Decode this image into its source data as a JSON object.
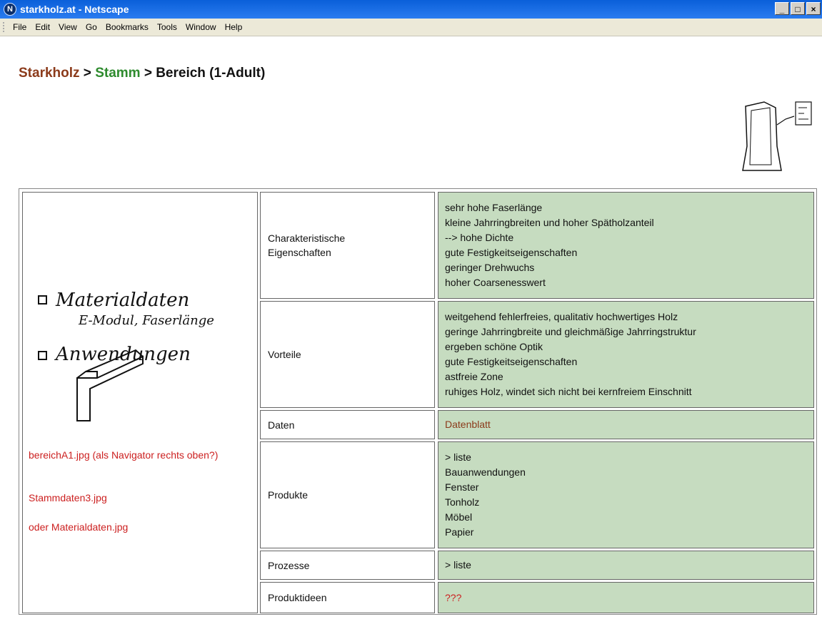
{
  "window": {
    "title": "starkholz.at - Netscape",
    "icon": "netscape-icon",
    "controls": [
      "_",
      "□",
      "×"
    ]
  },
  "menu": [
    "File",
    "Edit",
    "View",
    "Go",
    "Bookmarks",
    "Tools",
    "Window",
    "Help"
  ],
  "breadcrumb": {
    "part1": "Starkholz",
    "sep1": " > ",
    "part2": "Stamm",
    "sep2": " > ",
    "part3": "Bereich (1-Adult)"
  },
  "left": {
    "sketch": {
      "item1_title": "Materialdaten",
      "item1_sub": "E-Modul, Faserlänge",
      "item2_title": "Anwendungen"
    },
    "notes": [
      "bereichA1.jpg (als Navigator rechts oben?)",
      "Stammdaten3.jpg",
      "oder Materialdaten.jpg"
    ]
  },
  "rows": [
    {
      "label": [
        "Charakteristische",
        "Eigenschaften"
      ],
      "values": [
        "sehr hohe Faserlänge",
        "kleine Jahrringbreiten und hoher Spätholzanteil",
        "--> hohe Dichte",
        "gute Festigkeitseigenschaften",
        "geringer Drehwuchs",
        "hoher Coarsenesswert"
      ]
    },
    {
      "label": [
        "Vorteile"
      ],
      "values": [
        "weitgehend fehlerfreies, qualitativ hochwertiges Holz",
        "geringe Jahrringbreite und gleichmäßige Jahrringstruktur",
        "ergeben schöne Optik",
        "gute Festigkeitseigenschaften",
        "astfreie Zone",
        "ruhiges Holz, windet sich nicht bei kernfreiem Einschnitt"
      ]
    },
    {
      "label": [
        "Daten"
      ],
      "values": [
        "Datenblatt"
      ]
    },
    {
      "label": [
        "Produkte"
      ],
      "values": [
        "> liste",
        "Bauanwendungen",
        "Fenster",
        "Tonholz",
        "Möbel",
        "Papier"
      ]
    },
    {
      "label": [
        "Prozesse"
      ],
      "values": [
        "> liste"
      ]
    },
    {
      "label": [
        "Produktideen"
      ],
      "values": [
        "???"
      ]
    }
  ],
  "colors": {
    "value_bg": "#c6dcc0",
    "link_red": "#cc2020",
    "brown": "#8b3a1a",
    "green": "#2e8b2e"
  }
}
